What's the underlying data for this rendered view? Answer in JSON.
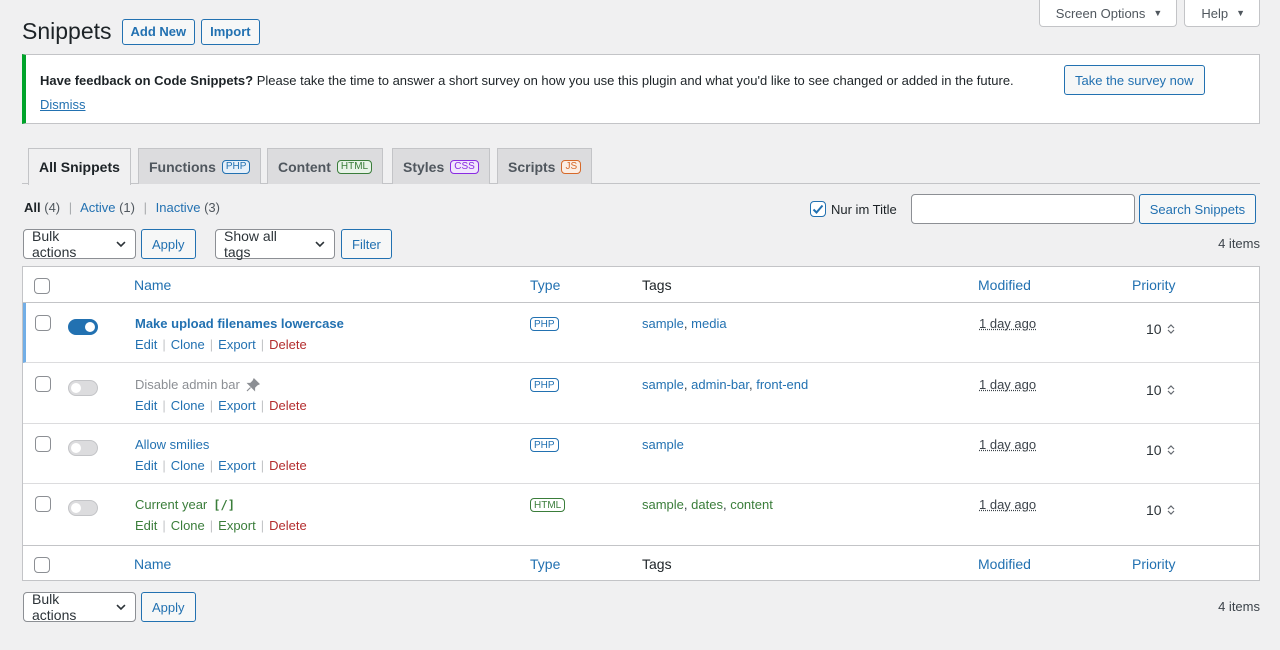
{
  "screen_meta": {
    "screen_options": "Screen Options",
    "help": "Help"
  },
  "header": {
    "title": "Snippets",
    "add_new": "Add New",
    "import": "Import"
  },
  "notice": {
    "bold": "Have feedback on Code Snippets?",
    "message": " Please take the time to answer a short survey on how you use this plugin and what you'd like to see changed or added in the future.",
    "dismiss": "Dismiss",
    "survey_button": "Take the survey now"
  },
  "tabs": [
    {
      "label": "All Snippets",
      "badge": ""
    },
    {
      "label": "Functions",
      "badge": "PHP"
    },
    {
      "label": "Content",
      "badge": "HTML"
    },
    {
      "label": "Styles",
      "badge": "CSS"
    },
    {
      "label": "Scripts",
      "badge": "JS"
    }
  ],
  "filters": {
    "all": "All",
    "all_count": "(4)",
    "active": "Active",
    "active_count": "(1)",
    "inactive": "Inactive",
    "inactive_count": "(3)",
    "sep": "|"
  },
  "search": {
    "checkbox_label": "Nur im Title",
    "value": "",
    "button": "Search Snippets"
  },
  "tablenav": {
    "bulk_actions": "Bulk actions",
    "apply": "Apply",
    "show_all_tags": "Show all tags",
    "filter": "Filter",
    "items": "4 items"
  },
  "columns": {
    "name": "Name",
    "type": "Type",
    "tags": "Tags",
    "modified": "Modified",
    "priority": "Priority"
  },
  "row_actions": {
    "edit": "Edit",
    "clone": "Clone",
    "export": "Export",
    "delete": "Delete",
    "sep": "|"
  },
  "snippets": [
    {
      "name": "Make upload filenames lowercase",
      "type": "PHP",
      "tags": [
        "sample",
        "media"
      ],
      "modified": "1 day ago",
      "priority": "10",
      "active": true
    },
    {
      "name": "Disable admin bar",
      "type": "PHP",
      "tags": [
        "sample",
        "admin-bar",
        "front-end"
      ],
      "modified": "1 day ago",
      "priority": "10",
      "active": false
    },
    {
      "name": "Allow smilies",
      "type": "PHP",
      "tags": [
        "sample"
      ],
      "modified": "1 day ago",
      "priority": "10",
      "active": false
    },
    {
      "name": "Current year",
      "shortcode": "[/]",
      "type": "HTML",
      "tags": [
        "sample",
        "dates",
        "content"
      ],
      "modified": "1 day ago",
      "priority": "10",
      "active": false
    }
  ],
  "colors": {
    "php": "#2271b1",
    "html": "#3a7d3a",
    "css": "#8a2be2",
    "js": "#d6692a",
    "notice_border": "#00a32a"
  }
}
